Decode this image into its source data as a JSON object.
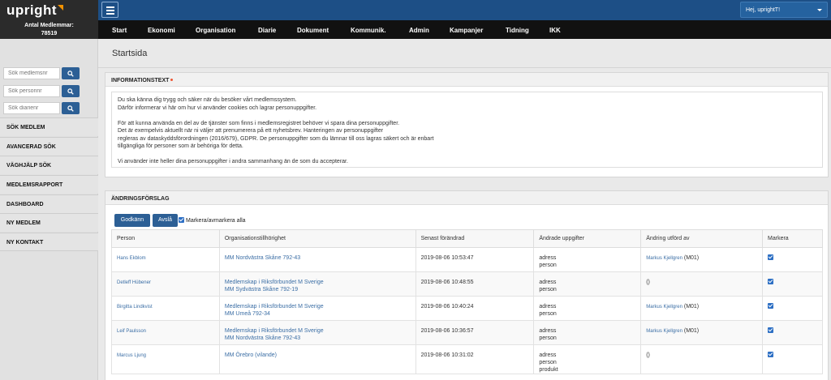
{
  "brand": {
    "logo": "upright",
    "member_label": "Antal Medlemmar:",
    "member_count": "78519"
  },
  "user": {
    "greeting": "Hej, uprightT!"
  },
  "nav": [
    "Start",
    "Ekonomi",
    "Organisation",
    "Diarie",
    "Dokument",
    "Kommunik.",
    "Admin",
    "Kampanjer",
    "Tidning",
    "IKK"
  ],
  "sidebar": {
    "searches": [
      {
        "placeholder": "Sök medlemsnr"
      },
      {
        "placeholder": "Sök personnr"
      },
      {
        "placeholder": "Sök diarienr"
      }
    ],
    "links": [
      "SÖK MEDLEM",
      "AVANCERAD SÖK",
      "VÄGHJÄLP SÖK",
      "MEDLEMSRAPPORT",
      "DASHBOARD",
      "NY MEDLEM",
      "NY KONTAKT"
    ]
  },
  "page": {
    "title": "Startsida"
  },
  "info": {
    "heading": "INFORMATIONSTEXT",
    "para1": [
      "Du ska känna dig trygg och säker när du besöker vårt medlemssystem.",
      "Därför informerar vi här om hur vi använder cookies och lagrar personuppgifter."
    ],
    "para2": [
      "För att kunna använda en del av de tjänster som finns i medlemsregistret behöver vi spara dina personuppgifter.",
      "Det är exempelvis aktuellt när ni väljer att prenumerera på ett nyhetsbrev. Hanteringen av personuppgifter",
      "regleras av dataskyddsförordningen (2016/679), GDPR. De personuppgifter som du lämnar till oss lagras säkert och är enbart",
      "tillgängliga för personer som är behöriga för detta."
    ],
    "para3": "Vi använder inte heller dina personuppgifter i andra sammanhang än de som du accepterar."
  },
  "changes": {
    "heading": "ÄNDRINGSFÖRSLAG",
    "approve_label": "Godkänn",
    "reject_label": "Avslå",
    "mark_all_label": "Markera/avmarkera alla",
    "columns": [
      "Person",
      "Organisationstillhörighet",
      "Senast förändrad",
      "Ändrade uppgifter",
      "Ändring utförd av",
      "Markera"
    ],
    "rows": [
      {
        "person": "Hans Ekblom",
        "org": [
          "MM Nordvästra Skåne 792-43"
        ],
        "changed": "2019-08-06 10:53:47",
        "fields": [
          "adress",
          "person"
        ],
        "by_name": "Markus Kjellgren",
        "by_code": "(M01)"
      },
      {
        "person": "Detleff Hübener",
        "org": [
          "Medlemskap i Riksförbundet M Sverige",
          "MM Sydvästra Skåne 792-19"
        ],
        "changed": "2019-08-06 10:48:55",
        "fields": [
          "adress",
          "person"
        ],
        "by_name": "",
        "by_code": "()"
      },
      {
        "person": "Birgitta Lindkvist",
        "org": [
          "Medlemskap i Riksförbundet M Sverige",
          "MM Umeå 792-34"
        ],
        "changed": "2019-08-06 10:40:24",
        "fields": [
          "adress",
          "person"
        ],
        "by_name": "Markus Kjellgren",
        "by_code": "(M01)"
      },
      {
        "person": "Leif Paulsson",
        "org": [
          "Medlemskap i Riksförbundet M Sverige",
          "MM Nordvästra Skåne 792-43"
        ],
        "changed": "2019-08-06 10:36:57",
        "fields": [
          "adress",
          "person"
        ],
        "by_name": "Markus Kjellgren",
        "by_code": "(M01)"
      },
      {
        "person": "Marcus Ljung",
        "org": [
          "MM Örebro (vilande)"
        ],
        "changed": "2019-08-06 10:31:02",
        "fields": [
          "adress",
          "person",
          "produkt"
        ],
        "by_name": "",
        "by_code": "()"
      }
    ]
  }
}
